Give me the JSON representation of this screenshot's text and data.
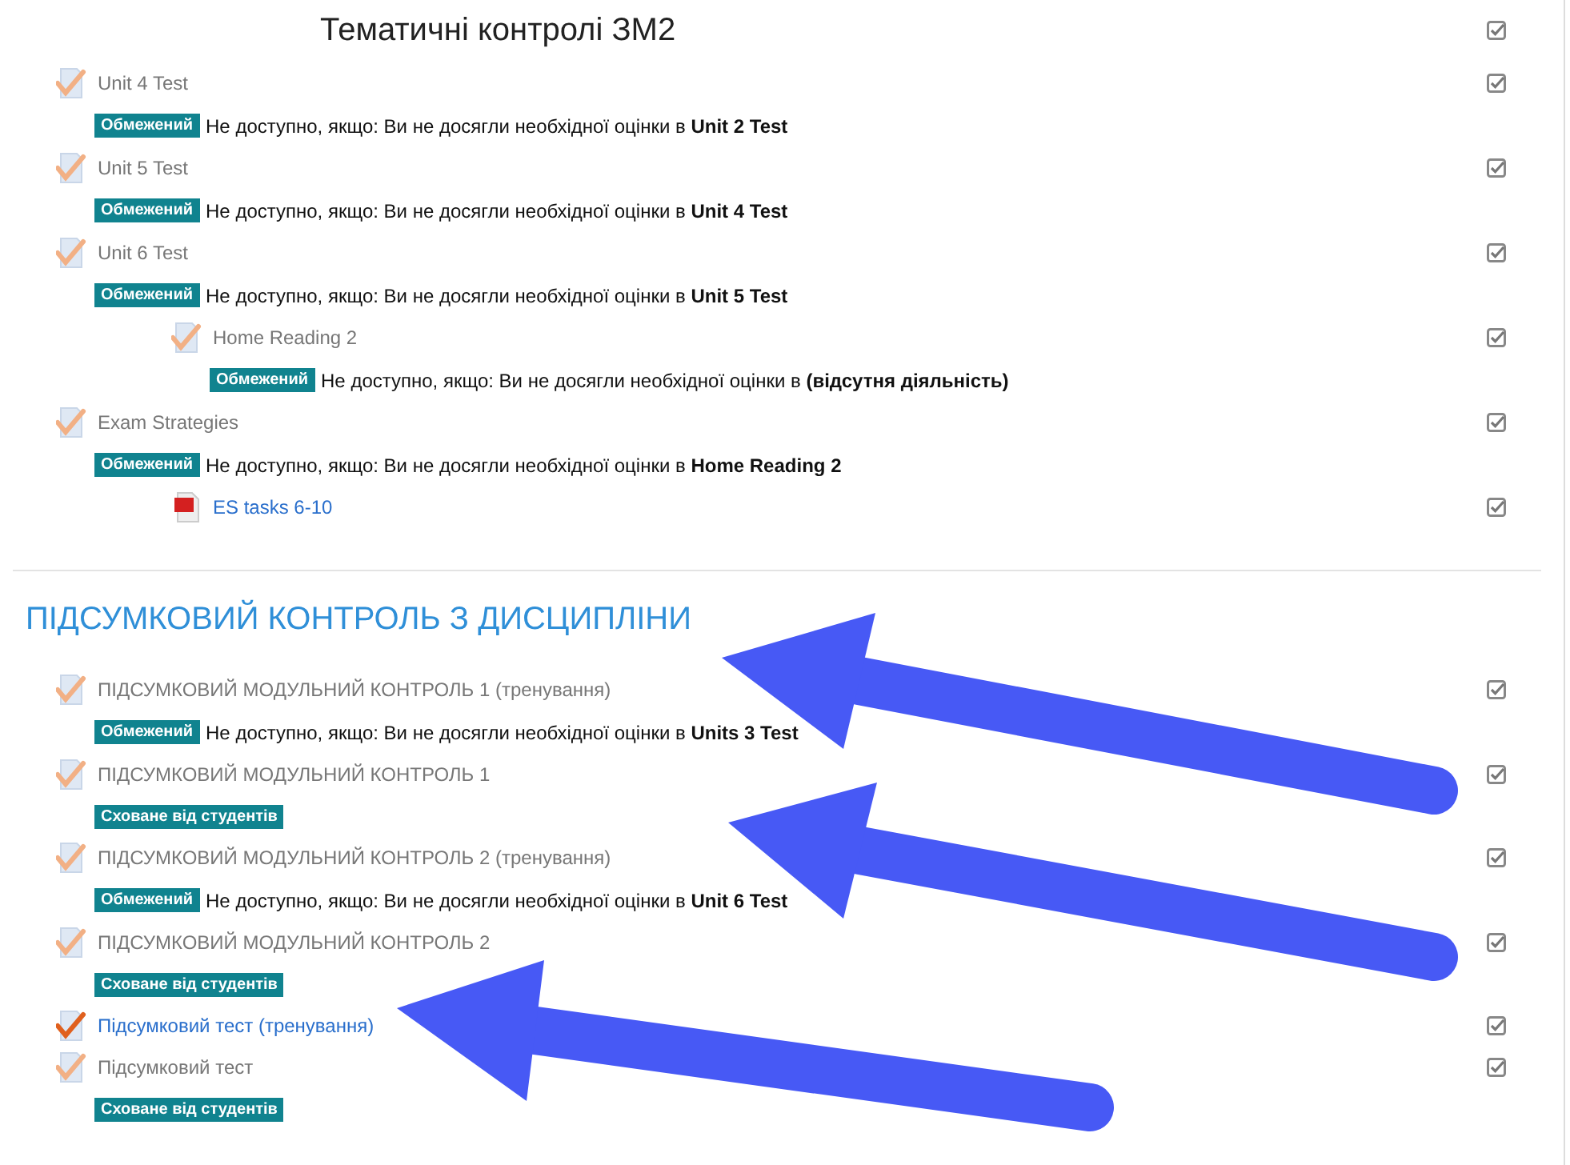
{
  "sections": [
    {
      "kind": "subheading",
      "title": "Тематичні контролі ЗМ2",
      "checked": true,
      "activities": [
        {
          "kind": "quiz",
          "name": "Unit 4 Test",
          "available": false,
          "checked": true,
          "note": {
            "kind": "restricted",
            "badge": "Обмежений",
            "text": "Не доступно, якщо: Ви не досягли необхідної оцінки в **Unit 2 Test**"
          }
        },
        {
          "kind": "quiz",
          "name": "Unit 5 Test",
          "available": false,
          "checked": true,
          "note": {
            "kind": "restricted",
            "badge": "Обмежений",
            "text": "Не доступно, якщо: Ви не досягли необхідної оцінки в **Unit 4 Test**"
          }
        },
        {
          "kind": "quiz",
          "name": "Unit 6 Test",
          "available": false,
          "checked": true,
          "note": {
            "kind": "restricted",
            "badge": "Обмежений",
            "text": "Не доступно, якщо: Ви не досягли необхідної оцінки в **Unit 5 Test**"
          },
          "children": [
            {
              "kind": "quiz",
              "name": "Home Reading 2",
              "available": false,
              "checked": true,
              "note": {
                "kind": "restricted",
                "badge": "Обмежений",
                "text": "Не доступно, якщо: Ви не досягли необхідної оцінки в **(відсутня діяльність)**"
              }
            }
          ]
        },
        {
          "kind": "quiz",
          "name": "Exam Strategies",
          "available": false,
          "checked": true,
          "note": {
            "kind": "restricted",
            "badge": "Обмежений",
            "text": "Не доступно, якщо: Ви не досягли необхідної оцінки в **Home Reading 2**"
          },
          "children": [
            {
              "kind": "pdf",
              "name": "ES tasks 6-10",
              "available": true,
              "checked": true
            }
          ]
        }
      ]
    },
    {
      "kind": "heading",
      "title": "ПІДСУМКОВИЙ КОНТРОЛЬ З ДИСЦИПЛІНИ",
      "activities": [
        {
          "kind": "quiz",
          "name": "ПІДСУМКОВИЙ МОДУЛЬНИЙ КОНТРОЛЬ 1 (тренування)",
          "available": false,
          "checked": true,
          "note": {
            "kind": "restricted",
            "badge": "Обмежений",
            "text": "Не доступно, якщо: Ви не досягли необхідної оцінки в **Units 3 Test**"
          }
        },
        {
          "kind": "quiz",
          "name": "ПІДСУМКОВИЙ МОДУЛЬНИЙ КОНТРОЛЬ 1",
          "available": false,
          "checked": true,
          "note": {
            "kind": "hidden",
            "badge": "Сховане від студентів"
          }
        },
        {
          "kind": "quiz",
          "name": "ПІДСУМКОВИЙ МОДУЛЬНИЙ КОНТРОЛЬ 2 (тренування)",
          "available": false,
          "checked": true,
          "note": {
            "kind": "restricted",
            "badge": "Обмежений",
            "text": "Не доступно, якщо: Ви не досягли необхідної оцінки в **Unit 6 Test**"
          }
        },
        {
          "kind": "quiz",
          "name": "ПІДСУМКОВИЙ МОДУЛЬНИЙ КОНТРОЛЬ 2",
          "available": false,
          "checked": true,
          "note": {
            "kind": "hidden",
            "badge": "Сховане від студентів"
          }
        },
        {
          "kind": "quiz",
          "name": "Підсумковий тест (тренування)",
          "available": true,
          "checked": true
        },
        {
          "kind": "quiz",
          "name": "Підсумковий тест",
          "available": false,
          "checked": true,
          "note": {
            "kind": "hidden",
            "badge": "Сховане від студентів"
          }
        }
      ]
    }
  ]
}
